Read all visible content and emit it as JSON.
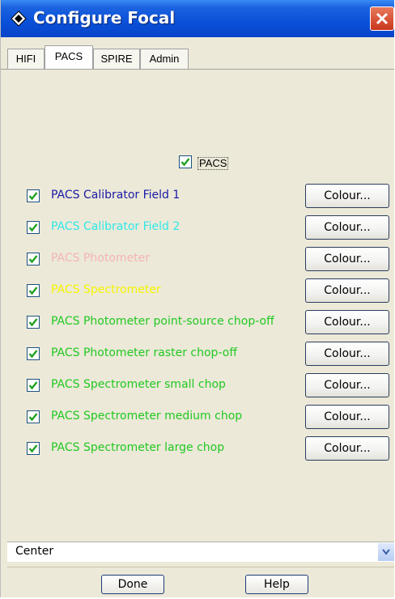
{
  "window": {
    "title": "Configure Focal",
    "icon": "diamond-app-icon",
    "close_icon": "close-icon"
  },
  "tabs": [
    {
      "label": "HIFI",
      "active": false
    },
    {
      "label": "PACS",
      "active": true
    },
    {
      "label": "SPIRE",
      "active": false
    },
    {
      "label": "Admin",
      "active": false
    }
  ],
  "master": {
    "label": "PACS",
    "checked": true
  },
  "rows": [
    {
      "label": "PACS Calibrator Field 1",
      "color": "#1a1aa6",
      "checked": true,
      "button": "Colour..."
    },
    {
      "label": "PACS Calibrator Field 2",
      "color": "#30e8e8",
      "checked": true,
      "button": "Colour..."
    },
    {
      "label": "PACS Photometer",
      "color": "#f4b4b4",
      "checked": true,
      "button": "Colour..."
    },
    {
      "label": "PACS Spectrometer",
      "color": "#f4f400",
      "checked": true,
      "button": "Colour..."
    },
    {
      "label": "PACS Photometer point-source chop-off",
      "color": "#22c822",
      "checked": true,
      "button": "Colour..."
    },
    {
      "label": "PACS Photometer raster chop-off",
      "color": "#22c822",
      "checked": true,
      "button": "Colour..."
    },
    {
      "label": "PACS Spectrometer small chop",
      "color": "#22c822",
      "checked": true,
      "button": "Colour..."
    },
    {
      "label": "PACS Spectrometer medium chop",
      "color": "#22c822",
      "checked": true,
      "button": "Colour..."
    },
    {
      "label": "PACS Spectrometer large chop",
      "color": "#22c822",
      "checked": true,
      "button": "Colour..."
    }
  ],
  "dropdown": {
    "value": "Center",
    "icon": "chevron-down-icon"
  },
  "buttons": {
    "done": "Done",
    "help": "Help"
  }
}
